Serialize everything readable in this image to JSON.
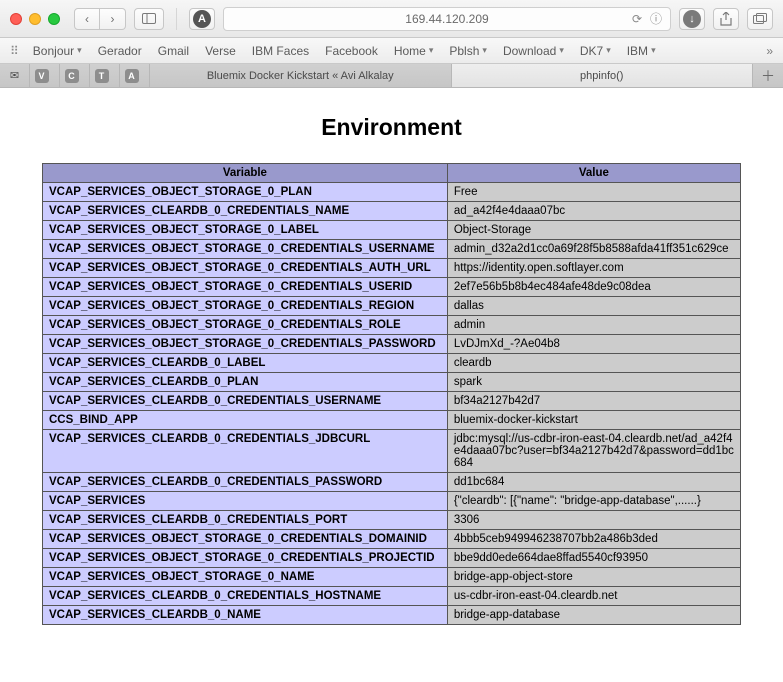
{
  "titlebar": {
    "address": "169.44.120.209"
  },
  "bookmarks": {
    "items": [
      {
        "label": "Bonjour",
        "dropdown": true
      },
      {
        "label": "Gerador",
        "dropdown": false
      },
      {
        "label": "Gmail",
        "dropdown": false
      },
      {
        "label": "Verse",
        "dropdown": false
      },
      {
        "label": "IBM Faces",
        "dropdown": false
      },
      {
        "label": "Facebook",
        "dropdown": false
      },
      {
        "label": "Home",
        "dropdown": true
      },
      {
        "label": "Pblsh",
        "dropdown": true
      },
      {
        "label": "Download",
        "dropdown": true
      },
      {
        "label": "DK7",
        "dropdown": true
      },
      {
        "label": "IBM",
        "dropdown": true
      }
    ]
  },
  "icon_tabs": [
    "V",
    "C",
    "T",
    "A"
  ],
  "tabs": {
    "tab1": "Bluemix Docker Kickstart « Avi Alkalay",
    "tab2": "phpinfo()"
  },
  "page": {
    "heading": "Environment",
    "col_variable": "Variable",
    "col_value": "Value",
    "rows": [
      {
        "k": "VCAP_SERVICES_OBJECT_STORAGE_0_PLAN",
        "v": "Free"
      },
      {
        "k": "VCAP_SERVICES_CLEARDB_0_CREDENTIALS_NAME",
        "v": "ad_a42f4e4daaa07bc"
      },
      {
        "k": "VCAP_SERVICES_OBJECT_STORAGE_0_LABEL",
        "v": "Object-Storage"
      },
      {
        "k": "VCAP_SERVICES_OBJECT_STORAGE_0_CREDENTIALS_USERNAME",
        "v": "admin_d32a2d1cc0a69f28f5b8588afda41ff351c629ce"
      },
      {
        "k": "VCAP_SERVICES_OBJECT_STORAGE_0_CREDENTIALS_AUTH_URL",
        "v": "https://identity.open.softlayer.com"
      },
      {
        "k": "VCAP_SERVICES_OBJECT_STORAGE_0_CREDENTIALS_USERID",
        "v": "2ef7e56b5b8b4ec484afe48de9c08dea"
      },
      {
        "k": "VCAP_SERVICES_OBJECT_STORAGE_0_CREDENTIALS_REGION",
        "v": "dallas"
      },
      {
        "k": "VCAP_SERVICES_OBJECT_STORAGE_0_CREDENTIALS_ROLE",
        "v": "admin"
      },
      {
        "k": "VCAP_SERVICES_OBJECT_STORAGE_0_CREDENTIALS_PASSWORD",
        "v": "LvDJmXd_-?Ae04b8"
      },
      {
        "k": "VCAP_SERVICES_CLEARDB_0_LABEL",
        "v": "cleardb"
      },
      {
        "k": "VCAP_SERVICES_CLEARDB_0_PLAN",
        "v": "spark"
      },
      {
        "k": "VCAP_SERVICES_CLEARDB_0_CREDENTIALS_USERNAME",
        "v": "bf34a2127b42d7"
      },
      {
        "k": "CCS_BIND_APP",
        "v": "bluemix-docker-kickstart"
      },
      {
        "k": "VCAP_SERVICES_CLEARDB_0_CREDENTIALS_JDBCURL",
        "v": "jdbc:mysql://us-cdbr-iron-east-04.cleardb.net/ad_a42f4e4daaa07bc?user=bf34a2127b42d7&password=dd1bc684"
      },
      {
        "k": "VCAP_SERVICES_CLEARDB_0_CREDENTIALS_PASSWORD",
        "v": "dd1bc684"
      },
      {
        "k": "VCAP_SERVICES",
        "v": "{\"cleardb\": [{\"name\": \"bridge-app-database\",......}"
      },
      {
        "k": "VCAP_SERVICES_CLEARDB_0_CREDENTIALS_PORT",
        "v": "3306"
      },
      {
        "k": "VCAP_SERVICES_OBJECT_STORAGE_0_CREDENTIALS_DOMAINID",
        "v": "4bbb5ceb949946238707bb2a486b3ded"
      },
      {
        "k": "VCAP_SERVICES_OBJECT_STORAGE_0_CREDENTIALS_PROJECTID",
        "v": "bbe9dd0ede664dae8ffad5540cf93950"
      },
      {
        "k": "VCAP_SERVICES_OBJECT_STORAGE_0_NAME",
        "v": "bridge-app-object-store"
      },
      {
        "k": "VCAP_SERVICES_CLEARDB_0_CREDENTIALS_HOSTNAME",
        "v": "us-cdbr-iron-east-04.cleardb.net"
      },
      {
        "k": "VCAP_SERVICES_CLEARDB_0_NAME",
        "v": "bridge-app-database"
      }
    ]
  }
}
